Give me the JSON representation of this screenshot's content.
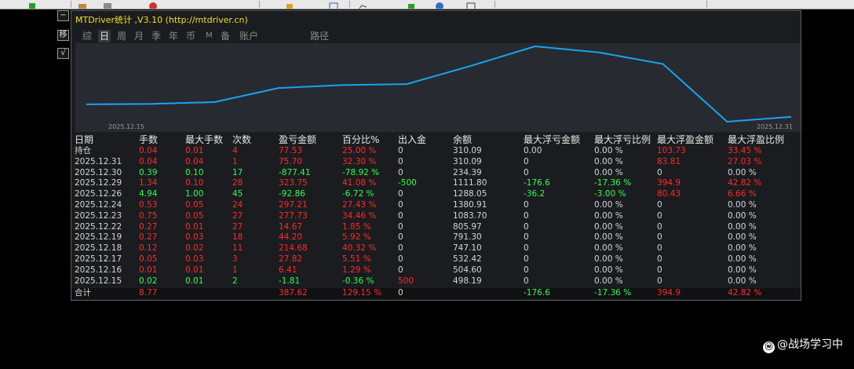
{
  "window": {
    "title": "MTDriver统计 ,V3.10 (http://mtdriver.cn)"
  },
  "side_buttons": [
    "−",
    "移",
    "√"
  ],
  "tabs": [
    {
      "label": "综",
      "active": false
    },
    {
      "label": "日",
      "active": true
    },
    {
      "label": "周",
      "active": false
    },
    {
      "label": "月",
      "active": false
    },
    {
      "label": "季",
      "active": false
    },
    {
      "label": "年",
      "active": false
    },
    {
      "label": "币",
      "active": false
    },
    {
      "label": "M",
      "active": false
    },
    {
      "label": "备",
      "active": false
    },
    {
      "label": "账户",
      "active": false
    },
    {
      "label": "路径",
      "active": false
    }
  ],
  "chart_data": {
    "type": "line",
    "x": [
      "2025.12.15",
      "2025.12.16",
      "2025.12.17",
      "2025.12.18",
      "2025.12.19",
      "2025.12.22",
      "2025.12.23",
      "2025.12.24",
      "2025.12.26",
      "2025.12.29",
      "2025.12.30",
      "2025.12.31"
    ],
    "series": [
      {
        "values": [
          498.19,
          504.6,
          532.42,
          747.1,
          791.3,
          805.97,
          1083.7,
          1380.91,
          1288.05,
          1111.8,
          234.39,
          310.09
        ]
      }
    ],
    "x_start_label": "2025.12.15",
    "x_end_label": "2025.12.31",
    "line_color": "#1aa3f0"
  },
  "table": {
    "headers": [
      "日期",
      "手数",
      "最大手数",
      "次数",
      "盈亏金额",
      "百分比%",
      "出入金",
      "余额",
      "最大浮亏金额",
      "最大浮亏比例",
      "最大浮盈金额",
      "最大浮盈比例"
    ],
    "rows": [
      {
        "cells": [
          "持仓",
          "0.04",
          "0.01",
          "4",
          "77.53",
          "25.00 %",
          "0",
          "310.09",
          "0.00",
          "0.00 %",
          "103.73",
          "33.45 %"
        ],
        "colors": [
          "w",
          "r",
          "r",
          "r",
          "r",
          "r",
          "w",
          "w",
          "w",
          "w",
          "r",
          "r"
        ]
      },
      {
        "cells": [
          "2025.12.31",
          "0.04",
          "0.04",
          "1",
          "75.70",
          "32.30 %",
          "0",
          "310.09",
          "0",
          "0.00 %",
          "83.81",
          "27.03 %"
        ],
        "colors": [
          "w",
          "r",
          "r",
          "r",
          "r",
          "r",
          "w",
          "w",
          "w",
          "w",
          "r",
          "r"
        ]
      },
      {
        "cells": [
          "2025.12.30",
          "0.39",
          "0.10",
          "17",
          "-877.41",
          "-78.92 %",
          "0",
          "234.39",
          "0",
          "0.00 %",
          "0",
          "0.00 %"
        ],
        "colors": [
          "w",
          "g",
          "g",
          "g",
          "g",
          "g",
          "w",
          "w",
          "w",
          "w",
          "w",
          "w"
        ]
      },
      {
        "cells": [
          "2025.12.29",
          "1.34",
          "0.10",
          "28",
          "323.75",
          "41.08 %",
          "-500",
          "1111.80",
          "-176.6",
          "-17.36 %",
          "394.9",
          "42.82 %"
        ],
        "colors": [
          "w",
          "r",
          "r",
          "r",
          "r",
          "r",
          "g",
          "w",
          "g",
          "g",
          "r",
          "r"
        ]
      },
      {
        "cells": [
          "2025.12.26",
          "4.94",
          "1.00",
          "45",
          "-92.86",
          "-6.72 %",
          "0",
          "1288.05",
          "-36.2",
          "-3.00 %",
          "80.43",
          "6.66 %"
        ],
        "colors": [
          "w",
          "g",
          "g",
          "g",
          "g",
          "g",
          "w",
          "w",
          "g",
          "g",
          "r",
          "r"
        ]
      },
      {
        "cells": [
          "2025.12.24",
          "0.53",
          "0.05",
          "24",
          "297.21",
          "27.43 %",
          "0",
          "1380.91",
          "0",
          "0.00 %",
          "0",
          "0.00 %"
        ],
        "colors": [
          "w",
          "r",
          "r",
          "r",
          "r",
          "r",
          "w",
          "w",
          "w",
          "w",
          "w",
          "w"
        ]
      },
      {
        "cells": [
          "2025.12.23",
          "0.75",
          "0.05",
          "27",
          "277.73",
          "34.46 %",
          "0",
          "1083.70",
          "0",
          "0.00 %",
          "0",
          "0.00 %"
        ],
        "colors": [
          "w",
          "r",
          "r",
          "r",
          "r",
          "r",
          "w",
          "w",
          "w",
          "w",
          "w",
          "w"
        ]
      },
      {
        "cells": [
          "2025.12.22",
          "0.27",
          "0.01",
          "27",
          "14.67",
          "1.85 %",
          "0",
          "805.97",
          "0",
          "0.00 %",
          "0",
          "0.00 %"
        ],
        "colors": [
          "w",
          "r",
          "r",
          "r",
          "r",
          "r",
          "w",
          "w",
          "w",
          "w",
          "w",
          "w"
        ]
      },
      {
        "cells": [
          "2025.12.19",
          "0.27",
          "0.03",
          "18",
          "44.20",
          "5.92 %",
          "0",
          "791.30",
          "0",
          "0.00 %",
          "0",
          "0.00 %"
        ],
        "colors": [
          "w",
          "r",
          "r",
          "r",
          "r",
          "r",
          "w",
          "w",
          "w",
          "w",
          "w",
          "w"
        ]
      },
      {
        "cells": [
          "2025.12.18",
          "0.12",
          "0.02",
          "11",
          "214.68",
          "40.32 %",
          "0",
          "747.10",
          "0",
          "0.00 %",
          "0",
          "0.00 %"
        ],
        "colors": [
          "w",
          "r",
          "r",
          "r",
          "r",
          "r",
          "w",
          "w",
          "w",
          "w",
          "w",
          "w"
        ]
      },
      {
        "cells": [
          "2025.12.17",
          "0.05",
          "0.03",
          "3",
          "27.82",
          "5.51 %",
          "0",
          "532.42",
          "0",
          "0.00 %",
          "0",
          "0.00 %"
        ],
        "colors": [
          "w",
          "r",
          "r",
          "r",
          "r",
          "r",
          "w",
          "w",
          "w",
          "w",
          "w",
          "w"
        ]
      },
      {
        "cells": [
          "2025.12.16",
          "0.01",
          "0.01",
          "1",
          "6.41",
          "1.29 %",
          "0",
          "504.60",
          "0",
          "0.00 %",
          "0",
          "0.00 %"
        ],
        "colors": [
          "w",
          "r",
          "r",
          "r",
          "r",
          "r",
          "w",
          "w",
          "w",
          "w",
          "w",
          "w"
        ]
      },
      {
        "cells": [
          "2025.12.15",
          "0.02",
          "0.01",
          "2",
          "-1.81",
          "-0.36 %",
          "500",
          "498.19",
          "0",
          "0.00 %",
          "0",
          "0.00 %"
        ],
        "colors": [
          "w",
          "g",
          "g",
          "g",
          "g",
          "g",
          "r",
          "w",
          "w",
          "w",
          "w",
          "w"
        ]
      }
    ],
    "totals": {
      "cells": [
        "合计",
        "8.77",
        "",
        "",
        "387.62",
        "129.15 %",
        "0",
        "",
        "-176.6",
        "-17.36 %",
        "394.9",
        "42.82 %"
      ],
      "colors": [
        "w",
        "r",
        "w",
        "w",
        "r",
        "r",
        "w",
        "w",
        "g",
        "g",
        "r",
        "r"
      ]
    }
  },
  "watermark": {
    "icon": "weibo-style-icon",
    "text": "@战场学习中"
  },
  "colors": {
    "red": "#ff2a2a",
    "green": "#28ff50",
    "white": "#d6d6d6",
    "title": "#f0e020",
    "line": "#1aa3f0"
  }
}
